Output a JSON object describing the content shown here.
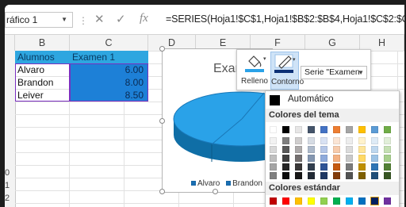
{
  "formula_bar": {
    "name_box": "ráfico 1",
    "cancel_glyph": "✕",
    "enter_glyph": "✓",
    "function_glyph": "fx",
    "formula": "=SERIES(Hoja1!$C$1,Hoja1!$B$2:$B$4,Hoja1!$C$2:$C$4,1)"
  },
  "columns": [
    "B",
    "C",
    "D",
    "E",
    "F",
    "G",
    "H"
  ],
  "row_numbers": [
    "0",
    "1",
    "2"
  ],
  "table": {
    "header": [
      "Alumnos",
      "Examen 1"
    ],
    "rows": [
      {
        "name": " Alvaro",
        "value": "6.00"
      },
      {
        "name": "Brandon",
        "value": "8.00"
      },
      {
        "name": "Leiver",
        "value": "8.50"
      }
    ]
  },
  "chart": {
    "title": "Exam",
    "legend": [
      {
        "label": "Alvaro",
        "color": "#1a6fb3"
      },
      {
        "label": "Brandon",
        "color": "#1a6fb3"
      }
    ]
  },
  "format_toolbar": {
    "fill_label": "Relleno",
    "outline_label": "Contorno",
    "series_selector": "Serie \"Examen"
  },
  "color_menu": {
    "automatic_label": "Automático",
    "theme_colors_label": "Colores del tema",
    "standard_colors_label": "Colores estándar",
    "theme_top": [
      "#ffffff",
      "#000000",
      "#e7e6e6",
      "#44546a",
      "#4472c4",
      "#ed7d31",
      "#a5a5a5",
      "#ffc000",
      "#5b9bd5",
      "#70ad47"
    ],
    "theme_shades": [
      [
        "#f2f2f2",
        "#7f7f7f",
        "#d0cece",
        "#d6dce4",
        "#d9e2f3",
        "#fbe5d5",
        "#ededed",
        "#fff2cc",
        "#deebf6",
        "#e2efd9"
      ],
      [
        "#d8d8d8",
        "#595959",
        "#aeabab",
        "#adb9ca",
        "#b4c6e7",
        "#f7cbac",
        "#dbdbdb",
        "#fee599",
        "#bdd7ee",
        "#c5e0b3"
      ],
      [
        "#bfbfbf",
        "#3f3f3f",
        "#757070",
        "#8496b0",
        "#8eaadb",
        "#f4b183",
        "#c9c9c9",
        "#ffd965",
        "#9cc3e5",
        "#a8d08d"
      ],
      [
        "#a5a5a5",
        "#262626",
        "#3a3838",
        "#323f4f",
        "#2f5496",
        "#c55a11",
        "#7b7b7b",
        "#bf9000",
        "#2e75b5",
        "#538135"
      ],
      [
        "#7f7f7f",
        "#0c0c0c",
        "#171616",
        "#222a35",
        "#1f3864",
        "#833c0b",
        "#525252",
        "#7f6000",
        "#1e4e79",
        "#375623"
      ]
    ],
    "standard": [
      "#c00000",
      "#ff0000",
      "#ffc000",
      "#ffff00",
      "#92d050",
      "#00b050",
      "#00b0f0",
      "#0070c0",
      "#002060",
      "#7030a0"
    ]
  }
}
